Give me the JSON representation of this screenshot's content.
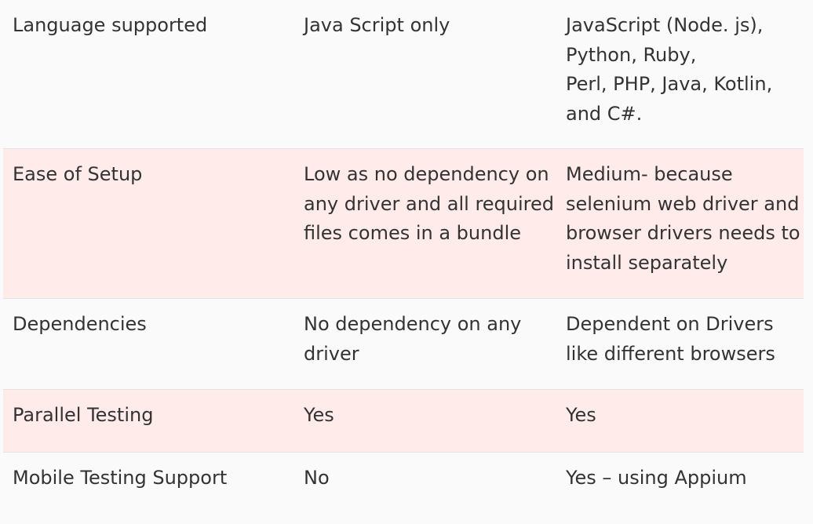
{
  "table": {
    "rows": [
      {
        "feature": "Language supported",
        "col2": "Java Script only",
        "col3": "JavaScript (Node. js),\nPython, Ruby,\nPerl, PHP, Java, Kotlin,\nand C#."
      },
      {
        "feature": "Ease of Setup",
        "col2": "Low as no dependency on\nany driver and all required\nfiles comes in a bundle",
        "col3": "Medium- because\nselenium web driver and\nbrowser drivers needs to\ninstall separately"
      },
      {
        "feature": "Dependencies",
        "col2": "No dependency on any\ndriver",
        "col3": "Dependent on Drivers\nlike different browsers"
      },
      {
        "feature": "Parallel Testing",
        "col2": "Yes",
        "col3": "Yes"
      },
      {
        "feature": "Mobile Testing Support",
        "col2": "No",
        "col3": "Yes – using Appium"
      }
    ],
    "colors": {
      "row_light": "#fafafa",
      "row_tinted": "#ffebea",
      "text": "#333333",
      "divider": "#e6e2e2"
    }
  }
}
